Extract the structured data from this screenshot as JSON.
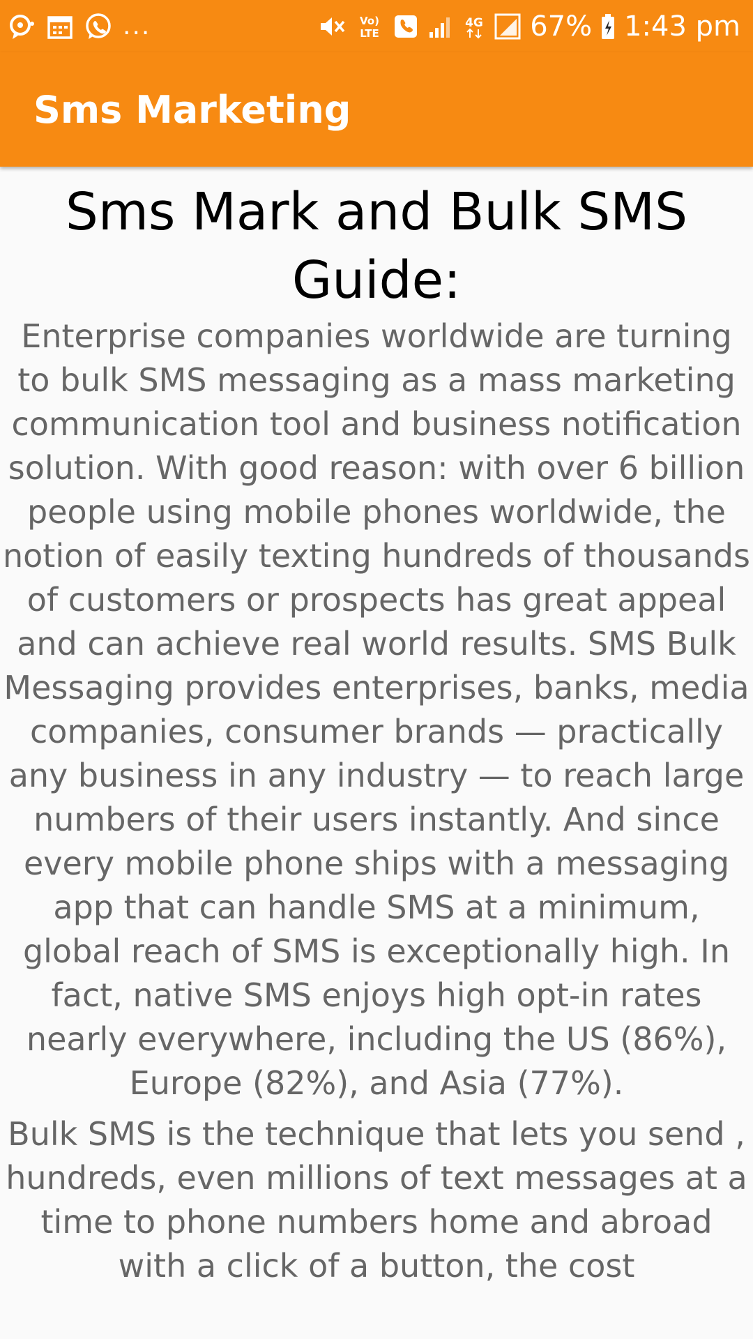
{
  "status_bar": {
    "time": "1:43 pm",
    "battery": "67%",
    "network_type": "4G",
    "volte": "Vo) LTE",
    "more_notifications": "...",
    "icons": [
      "messenger-icon",
      "calendar-icon",
      "whatsapp-icon",
      "mute-icon",
      "volte-icon",
      "phone-icon",
      "signal-icon",
      "signal-icon",
      "battery-icon"
    ]
  },
  "app_bar": {
    "title": "Sms Marketing"
  },
  "article": {
    "heading": "Sms Mark and Bulk SMS Guide:",
    "paragraphs": [
      "Enterprise companies worldwide are turning to bulk SMS messaging as a mass marketing communication tool and business notification solution. With good reason: with over 6 billion people using mobile phones worldwide, the notion of easily texting hundreds of thousands of customers or prospects has great appeal and can achieve real world results. SMS Bulk Messaging provides enterprises, banks, media companies, consumer brands — practically any business in any industry — to reach large numbers of their users instantly. And since every mobile phone ships with a messaging app that can handle SMS at a minimum, global reach of SMS is exceptionally high. In fact, native SMS enjoys high opt-in rates nearly everywhere, including the US (86%), Europe (82%), and Asia (77%).",
      "Bulk SMS is the technique that lets you send , hundreds, even millions of text messages at a time to phone numbers home and abroad with a click of a button, the cost"
    ]
  },
  "colors": {
    "primary": "#f78a12",
    "heading_text": "#000000",
    "body_text": "#666666",
    "background": "#fafafa"
  }
}
